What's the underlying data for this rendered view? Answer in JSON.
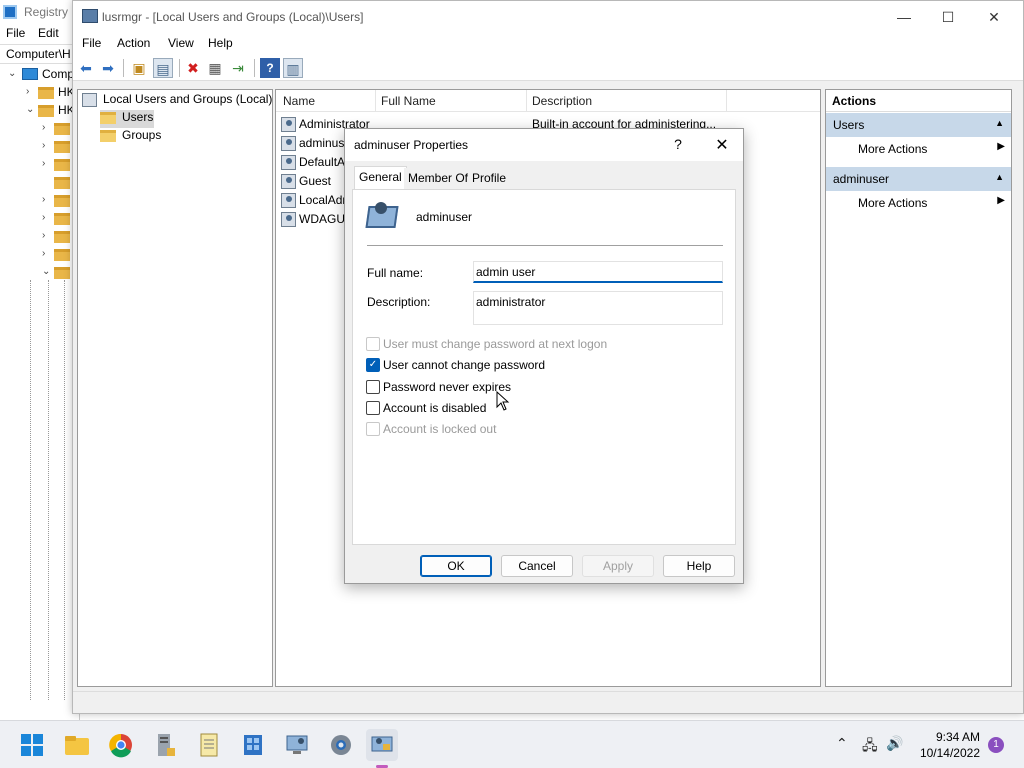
{
  "registry_editor": {
    "title": "Registry E",
    "menu": [
      "File",
      "Edit"
    ],
    "address": "Computer\\H",
    "root_label": "Comp",
    "hk1": "HK",
    "hk2": "HK"
  },
  "window": {
    "title": "lusrmgr - [Local Users and Groups (Local)\\Users]",
    "menu": [
      "File",
      "Action",
      "View",
      "Help"
    ],
    "caption": {
      "minimize": "—",
      "maximize": "☐",
      "close": "✕"
    }
  },
  "tree": {
    "root": "Local Users and Groups (Local)",
    "children": [
      "Users",
      "Groups"
    ]
  },
  "list": {
    "columns": [
      "Name",
      "Full Name",
      "Description"
    ],
    "rows": [
      {
        "name": "Administrator",
        "description": "Built-in account for administering..."
      },
      {
        "name": "adminus",
        "description": ""
      },
      {
        "name": "DefaultA",
        "description": ""
      },
      {
        "name": "Guest",
        "description": ""
      },
      {
        "name": "LocalAdr",
        "description": ""
      },
      {
        "name": "WDAGUt",
        "description": ""
      }
    ]
  },
  "actions": {
    "heading": "Actions",
    "sections": [
      {
        "title": "Users",
        "items": [
          "More Actions"
        ]
      },
      {
        "title": "adminuser",
        "items": [
          "More Actions"
        ]
      }
    ]
  },
  "dialog": {
    "title": "adminuser Properties",
    "help_glyph": "?",
    "close_glyph": "✕",
    "tabs": [
      "General",
      "Member Of",
      "Profile"
    ],
    "active_tab": "General",
    "username": "adminuser",
    "full_name_label": "Full name:",
    "full_name_value": "admin user",
    "description_label": "Description:",
    "description_value": "administrator",
    "options": [
      {
        "label": "User must change password at next logon",
        "checked": false,
        "disabled": true
      },
      {
        "label": "User cannot change password",
        "checked": true,
        "disabled": false
      },
      {
        "label": "Password never expires",
        "checked": false,
        "disabled": false
      },
      {
        "label": "Account is disabled",
        "checked": false,
        "disabled": false
      },
      {
        "label": "Account is locked out",
        "checked": false,
        "disabled": true
      }
    ],
    "buttons": {
      "ok": "OK",
      "cancel": "Cancel",
      "apply": "Apply",
      "help": "Help"
    }
  },
  "taskbar": {
    "time": "9:34 AM",
    "date": "10/14/2022",
    "notification_count": "1"
  },
  "colors": {
    "accent": "#005fb8",
    "action_section": "#c7d8e9"
  }
}
